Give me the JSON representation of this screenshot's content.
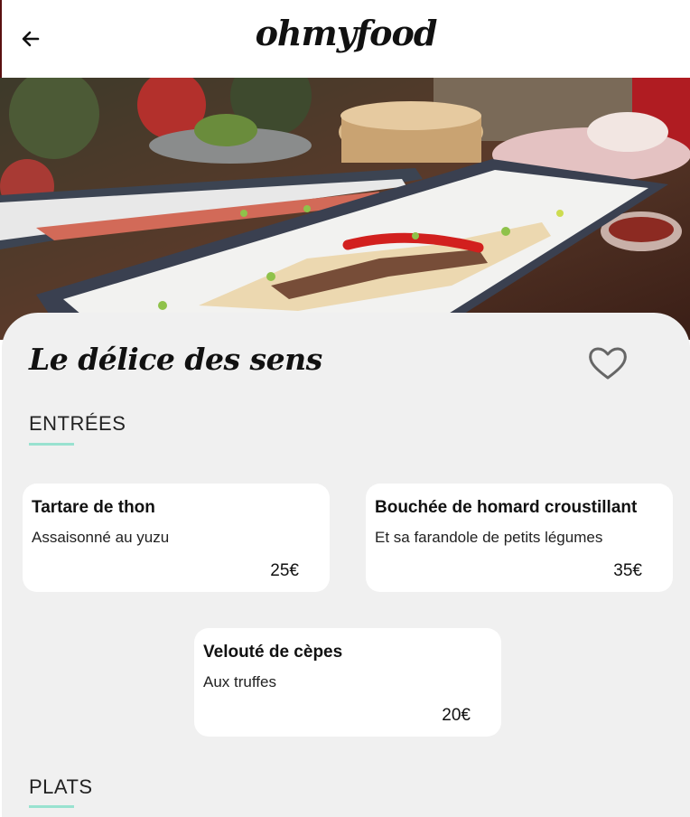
{
  "header": {
    "logo": "ohmyfood"
  },
  "restaurant": {
    "name": "Le délice des sens"
  },
  "menu": {
    "entrees": {
      "title": "ENTRÉES",
      "items": [
        {
          "name": "Tartare de thon",
          "description": "Assaisonné au yuzu",
          "price": "25€"
        },
        {
          "name": "Bouchée de homard croustillant",
          "description": "Et sa farandole de petits légumes",
          "price": "35€"
        },
        {
          "name": "Velouté de cèpes",
          "description": "Aux truffes",
          "price": "20€"
        }
      ]
    },
    "plats": {
      "title": "PLATS"
    }
  },
  "colors": {
    "accent": "#99e2d0",
    "panel": "#f0f0f0",
    "text": "#111111"
  },
  "icons": {
    "back": "arrow-left-icon",
    "favorite": "heart-outline-icon"
  }
}
